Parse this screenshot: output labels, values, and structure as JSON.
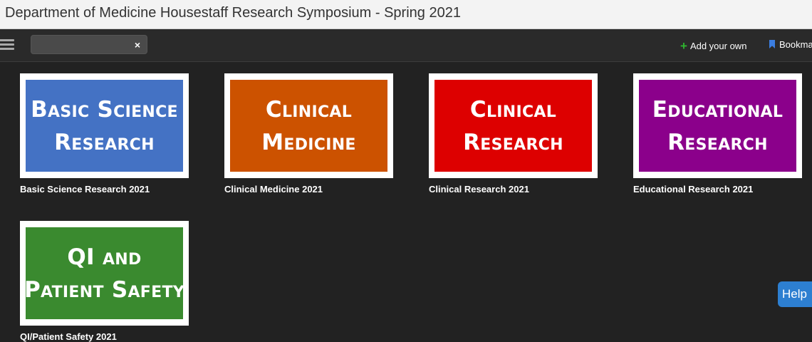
{
  "window": {
    "title": "Department of Medicine Housestaff Research Symposium - Spring 2021"
  },
  "toolbar": {
    "search_value": "",
    "clear_glyph": "×",
    "add_own_label": "Add your own",
    "bookmark_label": "Bookmarks"
  },
  "tiles": [
    {
      "line1": "Basic Science",
      "line2": "Research",
      "caption": "Basic Science Research 2021",
      "color": "#4472c4"
    },
    {
      "line1": "Clinical",
      "line2": "Medicine",
      "caption": "Clinical Medicine 2021",
      "color": "#cc5200"
    },
    {
      "line1": "Clinical",
      "line2": "Research",
      "caption": "Clinical Research 2021",
      "color": "#dd0000"
    },
    {
      "line1": "Educational",
      "line2": "Research",
      "caption": "Educational Research 2021",
      "color": "#8b008b"
    },
    {
      "line1": "QI and",
      "line2": "Patient Safety",
      "caption": "QI/Patient Safety 2021",
      "color": "#3a8a2f"
    }
  ],
  "help": {
    "label": "Help"
  },
  "icons": {
    "menu": "hamburger-icon",
    "add": "plus-icon",
    "bookmark": "bookmark-icon",
    "clear": "close-icon"
  }
}
